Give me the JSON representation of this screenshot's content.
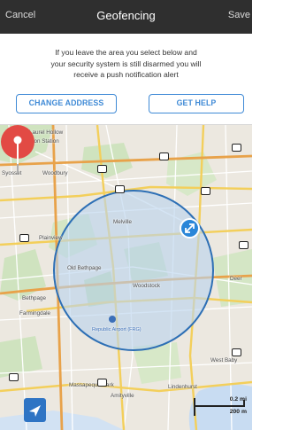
{
  "navbar": {
    "cancel": "Cancel",
    "title": "Geofencing",
    "save": "Save"
  },
  "info": {
    "line1": "If you leave the area you select below and",
    "line2": "your security system is still disarmed you will",
    "line3": "receive a push notification alert",
    "change_address": "CHANGE ADDRESS",
    "get_help": "GET HELP"
  },
  "map": {
    "labels": {
      "laurel_hollow": "Laurel Hollow",
      "huntington_station": "Huntington Station",
      "syosset": "Syosset",
      "woodbury": "Woodbury",
      "melville": "Melville",
      "plainview": "Plainview",
      "old_bethpage": "Old Bethpage",
      "woodstock": "Woodstock",
      "deer": "Deer",
      "bethpage": "Bethpage",
      "farmingdale": "Farmingdale",
      "republic_airport": "Republic Airport (FRG)",
      "west_babylon": "West Baby",
      "massapequa_park": "Massapequa Park",
      "amityville": "Amityville",
      "lindenhurst": "Lindenhurst"
    },
    "scale": {
      "miles": "0.2 mi",
      "meters": "200 m"
    },
    "icons": {
      "pin": "map-pin-icon",
      "resize": "resize-arrows-icon",
      "locate": "location-arrow-icon"
    },
    "colors": {
      "accent": "#2a86d8",
      "pin": "#e24a44",
      "fence_fill": "#b9d4ee",
      "fence_stroke": "#2d6fb5"
    }
  }
}
